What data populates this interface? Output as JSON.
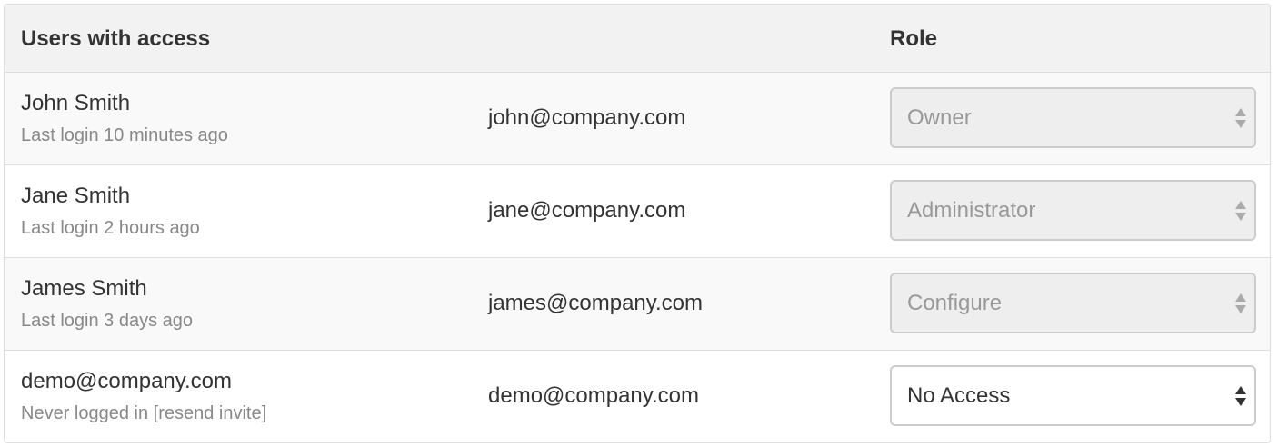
{
  "table": {
    "header_users": "Users with access",
    "header_role": "Role",
    "rows": [
      {
        "name": "John Smith",
        "status": "Last login 10 minutes ago",
        "email": "john@company.com",
        "role": "Owner",
        "role_disabled": true
      },
      {
        "name": "Jane Smith",
        "status": "Last login 2 hours ago",
        "email": "jane@company.com",
        "role": "Administrator",
        "role_disabled": true
      },
      {
        "name": "James Smith",
        "status": "Last login 3 days ago",
        "email": "james@company.com",
        "role": "Configure",
        "role_disabled": true
      },
      {
        "name": "demo@company.com",
        "status": "Never logged in [resend invite]",
        "email": "demo@company.com",
        "role": "No Access",
        "role_disabled": false
      }
    ]
  },
  "colors": {
    "header_bg": "#f2f2f2",
    "stripe_bg": "#f9f9f9",
    "border": "#dddddd",
    "disabled_select_bg": "#eeeeee",
    "muted_text": "#888888",
    "disabled_text": "#999999",
    "text": "#333333"
  },
  "icons": {
    "select_arrow": "updown-icon"
  }
}
